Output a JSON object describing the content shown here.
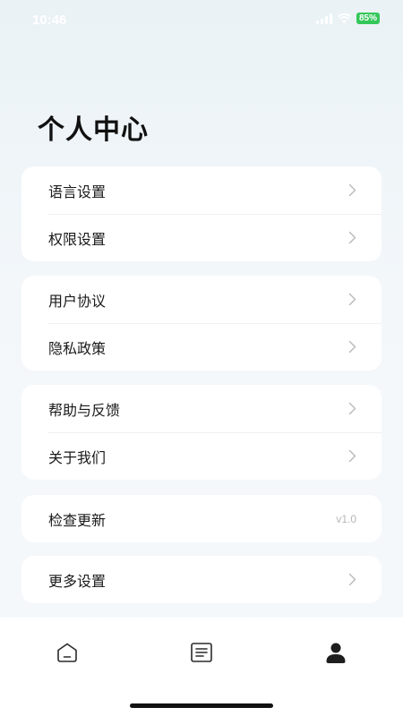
{
  "status_bar": {
    "time": "10:46",
    "battery": "85%"
  },
  "page": {
    "title": "个人中心"
  },
  "groups": [
    {
      "items": [
        {
          "label": "语言设置",
          "trailing": "chevron"
        },
        {
          "label": "权限设置",
          "trailing": "chevron"
        }
      ]
    },
    {
      "items": [
        {
          "label": "用户协议",
          "trailing": "chevron"
        },
        {
          "label": "隐私政策",
          "trailing": "chevron"
        }
      ]
    },
    {
      "items": [
        {
          "label": "帮助与反馈",
          "trailing": "chevron"
        },
        {
          "label": "关于我们",
          "trailing": "chevron"
        }
      ]
    },
    {
      "items": [
        {
          "label": "检查更新",
          "trailing": "text",
          "value": "v1.0"
        }
      ]
    },
    {
      "items": [
        {
          "label": "更多设置",
          "trailing": "chevron"
        }
      ]
    }
  ],
  "tab_bar": {
    "tabs": [
      {
        "icon": "home-icon",
        "active": false
      },
      {
        "icon": "document-list-icon",
        "active": false
      },
      {
        "icon": "user-profile-icon",
        "active": true
      }
    ]
  },
  "colors": {
    "background": "#eef4f7",
    "card": "#ffffff",
    "text": "#1a1a1a",
    "chevron": "#b8b8b8",
    "battery": "#34c759"
  }
}
